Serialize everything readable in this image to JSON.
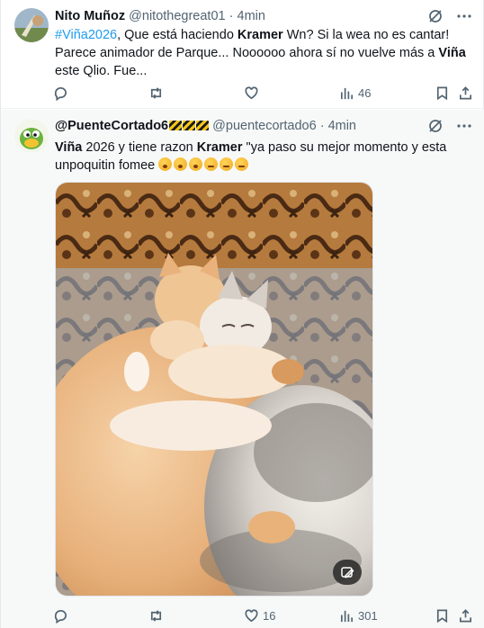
{
  "tweets": [
    {
      "author_name": "Nito Muñoz",
      "handle": "@nitothegreat01",
      "separator": "·",
      "time": "4min",
      "text": {
        "hashtag": "#Viña2026",
        "part1": ", Que está haciendo ",
        "bold1": "Kramer",
        "part2": " Wn? Si la wea no es cantar! Parece animador de Parque... Noooooo ahora sí no vuelve más a ",
        "bold2": "Viña",
        "part3": " este Qlio. Fue..."
      },
      "stats": {
        "reply": "",
        "retweet": "",
        "like": "",
        "views": "46"
      }
    },
    {
      "author_name": "@PuenteCortado6",
      "handle": "@puentecortado6",
      "separator": "·",
      "time": "4min",
      "text": {
        "bold1": "Viña",
        "part1": " 2026 y tiene razon ",
        "bold2": "Kramer",
        "part2": " \"ya paso su mejor momento y esta unpoquitin fomee "
      },
      "emojis": [
        "yawning-face",
        "yawning-face",
        "yawning-face",
        "sleeping-face",
        "sleeping-face",
        "sleeping-face"
      ],
      "image_alt_button": "edit-alt",
      "stats": {
        "reply": "",
        "retweet": "",
        "like": "16",
        "views": "301"
      }
    }
  ],
  "colors": {
    "link": "#1d9bf0",
    "muted": "#536471",
    "text": "#0f1419"
  }
}
